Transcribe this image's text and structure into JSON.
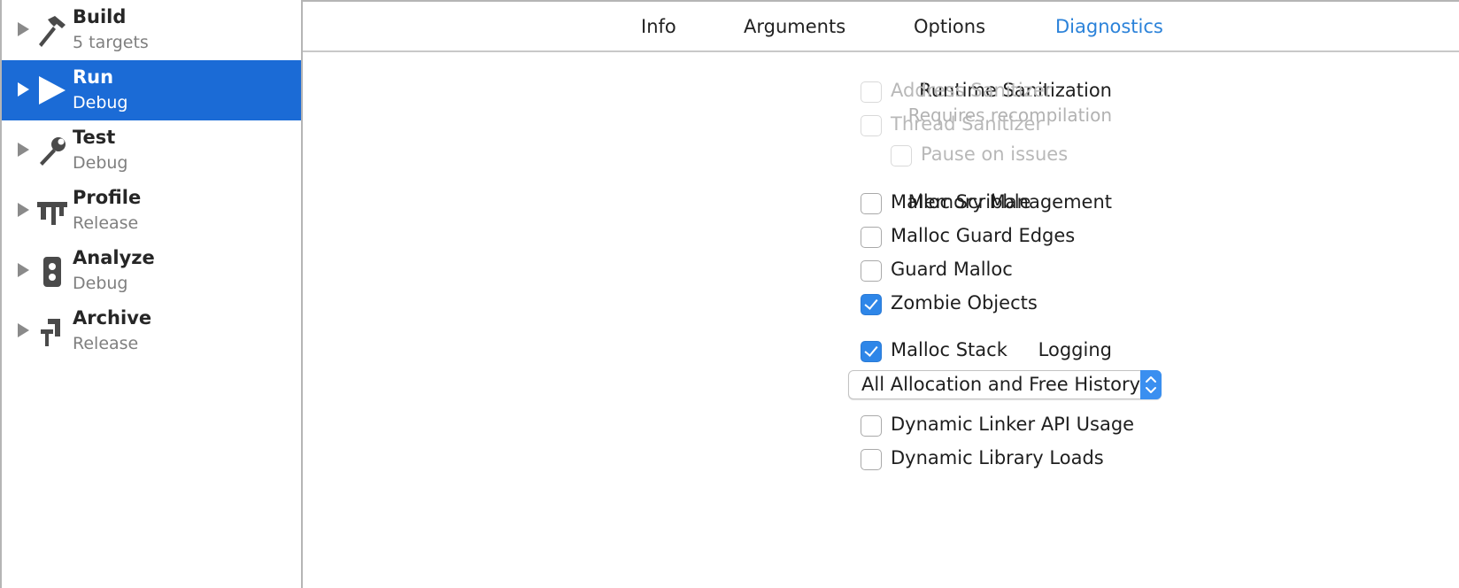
{
  "sidebar": {
    "actions": [
      {
        "name": "Build",
        "sub": "5 targets",
        "icon": "hammer-icon"
      },
      {
        "name": "Run",
        "sub": "Debug",
        "icon": "play-icon"
      },
      {
        "name": "Test",
        "sub": "Debug",
        "icon": "wrench-icon"
      },
      {
        "name": "Profile",
        "sub": "Release",
        "icon": "caliper-icon"
      },
      {
        "name": "Analyze",
        "sub": "Debug",
        "icon": "analyze-icon"
      },
      {
        "name": "Archive",
        "sub": "Release",
        "icon": "vise-icon"
      }
    ],
    "selected": "Run"
  },
  "tabs": {
    "info": "Info",
    "arguments": "Arguments",
    "options": "Options",
    "diagnostics": "Diagnostics",
    "active": "Diagnostics"
  },
  "runtime_sanitization": {
    "label": "Runtime Sanitization",
    "note": "Requires recompilation",
    "address_sanitizer": {
      "label": "Address Sanitizer",
      "checked": false,
      "enabled": false
    },
    "thread_sanitizer": {
      "label": "Thread Sanitizer",
      "checked": false,
      "enabled": false
    },
    "pause_on_issues": {
      "label": "Pause on issues",
      "checked": false,
      "enabled": false
    }
  },
  "memory_management": {
    "label": "Memory Management",
    "malloc_scribble": {
      "label": "Malloc Scribble",
      "checked": false
    },
    "malloc_guard_edges": {
      "label": "Malloc Guard Edges",
      "checked": false
    },
    "guard_malloc": {
      "label": "Guard Malloc",
      "checked": false
    },
    "zombie_objects": {
      "label": "Zombie Objects",
      "checked": true
    }
  },
  "logging": {
    "label": "Logging",
    "malloc_stack": {
      "label": "Malloc Stack",
      "checked": true
    },
    "malloc_stack_mode": "All Allocation and Free History",
    "dynamic_linker_api_usage": {
      "label": "Dynamic Linker API Usage",
      "checked": false
    },
    "dynamic_library_loads": {
      "label": "Dynamic Library Loads",
      "checked": false
    }
  },
  "colors": {
    "selection": "#1b6bd6",
    "active_tab": "#2b82d9",
    "checkbox_checked": "#2e86e8"
  }
}
